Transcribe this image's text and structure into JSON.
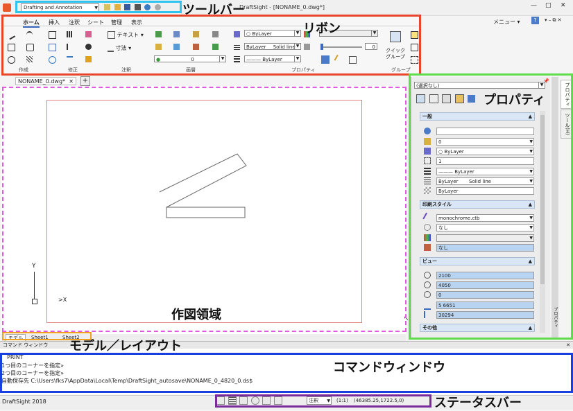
{
  "titlebar": {
    "workspace": "Drafting and Annotation",
    "title": "DraftSight - [NONAME_0.dwg*]",
    "menu_label": "メニュー",
    "help_label": "?"
  },
  "ribbon": {
    "tabs": [
      "ホーム",
      "挿入",
      "注釈",
      "シート",
      "管理",
      "表示"
    ],
    "groups": [
      "作成",
      "修正",
      "注釈",
      "画層",
      "プロパティ",
      "グループ"
    ],
    "text_label": "テキスト",
    "dim_label": "寸法",
    "layer_value": "0",
    "bylayer_color": "ByLayer",
    "linestyle": "ByLayer",
    "linestyle_type": "Solid line",
    "lineweight": "ByLayer",
    "opacity_value": "0",
    "quick_group": "クイック\nグループ"
  },
  "document_tab": {
    "label": "NONAME_0.dwg*",
    "close": "✕",
    "add": "+"
  },
  "drawing": {
    "axis_y": "Y",
    "axis_x": "X"
  },
  "layout_tabs": [
    "モデル",
    "Sheet1",
    "Sheet2"
  ],
  "properties": {
    "selection": "(選択なし)",
    "sections": {
      "general": "一般",
      "print_style": "印刷スタイル",
      "view": "ビュー",
      "other": "その他"
    },
    "general_rows": [
      "",
      "0",
      "ByLayer",
      "1",
      "ByLayer",
      "ByLayer       Solid line",
      "ByLayer"
    ],
    "print_rows": [
      "monochrome.ctb",
      "なし",
      "",
      "なし"
    ],
    "view_rows": [
      "2100",
      "4050",
      "0",
      "5 6651",
      "30294"
    ],
    "side_tabs": [
      "プロパティ",
      "ツール(H)"
    ],
    "bottom_side": "プロパティ"
  },
  "command": {
    "header": "コマンド ウィンドウ",
    "lines": [
      "PRINT",
      "1つ目のコーナーを指定»",
      "2つ目のコーナーを指定»",
      "自動保存先 C:\\Users\\fks7\\AppData\\Local\\Temp\\DraftSight_autosave\\NONAME_0_4820_0.ds$"
    ]
  },
  "statusbar": {
    "app": "DraftSight 2018",
    "annotate": "注釈",
    "scale": "(1:1)",
    "coords": "(46385.25,1722.5,0)"
  },
  "annotations": {
    "toolbar": "ツールバー",
    "ribbon": "リボン",
    "properties": "プロパティ",
    "drawing_area": "作図領域",
    "model_layout": "モデル／レイアウト",
    "command_window": "コマンドウィンドウ",
    "status_bar": "ステータスバー",
    "colors": {
      "toolbar": "#2ec4f0",
      "ribbon": "#e8452a",
      "properties": "#5fdc4a",
      "drawing_area": "#e05ae0",
      "model_layout": "#f0a020",
      "command_window": "#1a3fe0",
      "status_bar": "#7a2a9a"
    }
  }
}
